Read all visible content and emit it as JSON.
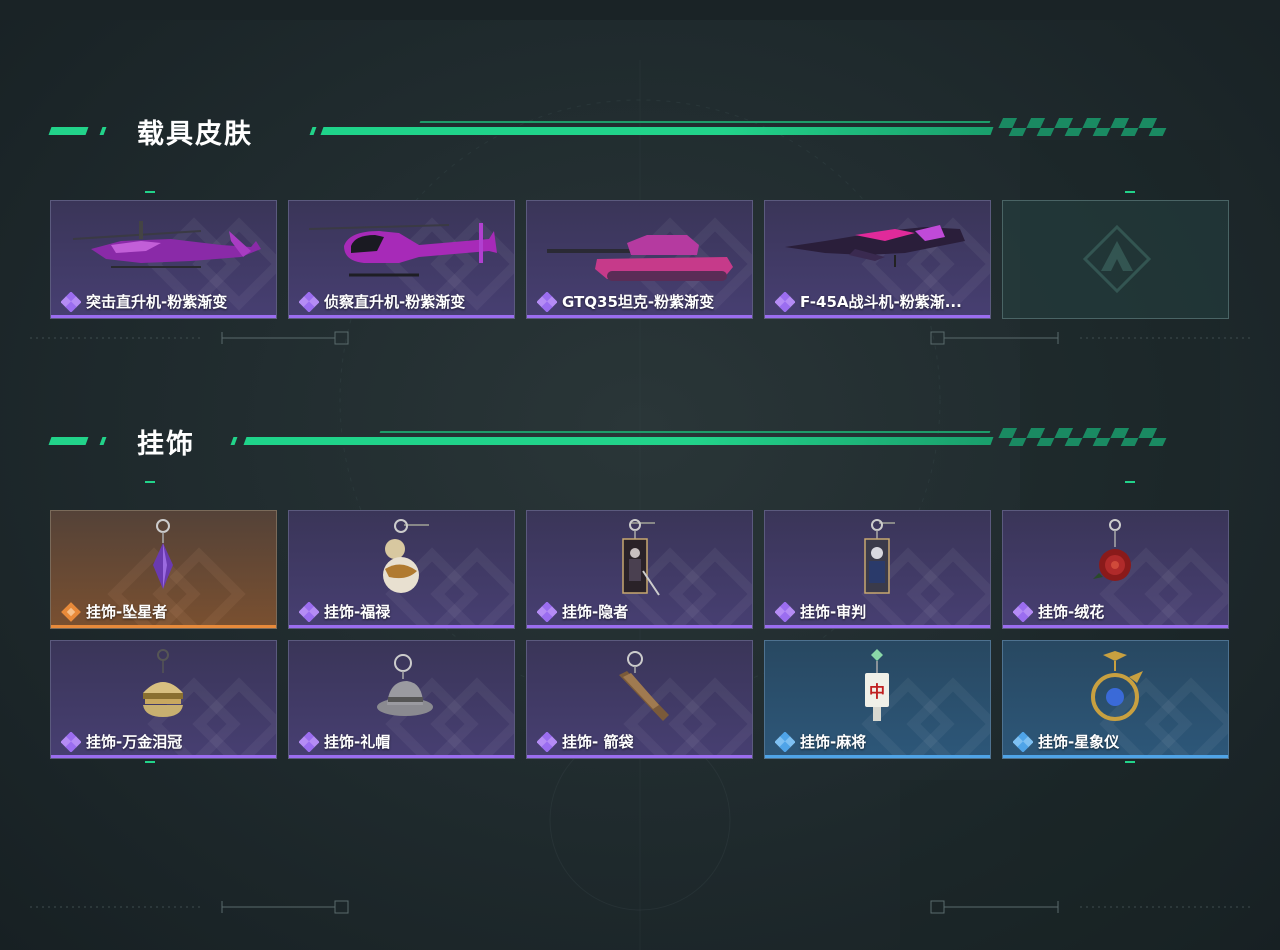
{
  "colors": {
    "accent_green": "#22d38a",
    "rare_purple": "#9b6df0",
    "legend_orange": "#e88a3a",
    "epic_blue": "#4fa4e8"
  },
  "sections": {
    "vehicle_skins": {
      "title": "载具皮肤",
      "items": [
        {
          "name": "突击直升机-粉紫渐变",
          "rarity": "purple",
          "icon": "attack-helicopter-icon"
        },
        {
          "name": "侦察直升机-粉紫渐变",
          "rarity": "purple",
          "icon": "scout-helicopter-icon"
        },
        {
          "name": "GTQ35坦克-粉紫渐变",
          "rarity": "purple",
          "icon": "tank-icon"
        },
        {
          "name": "F-45A战斗机-粉紫渐...",
          "rarity": "purple",
          "icon": "fighter-jet-icon"
        },
        {
          "name": "",
          "rarity": "empty",
          "icon": "game-logo-icon"
        }
      ]
    },
    "charms": {
      "title": "挂饰",
      "items": [
        {
          "name": "挂饰-坠星者",
          "rarity": "orange",
          "icon": "crystal-charm-icon"
        },
        {
          "name": "挂饰-福禄",
          "rarity": "purple",
          "icon": "gourd-charm-icon"
        },
        {
          "name": "挂饰-隐者",
          "rarity": "purple",
          "icon": "tarot-card-charm-icon"
        },
        {
          "name": "挂饰-审判",
          "rarity": "purple",
          "icon": "tarot-card-charm-icon"
        },
        {
          "name": "挂饰-绒花",
          "rarity": "purple",
          "icon": "rose-charm-icon"
        },
        {
          "name": "挂饰-万金泪冠",
          "rarity": "purple",
          "icon": "burger-charm-icon"
        },
        {
          "name": "挂饰-礼帽",
          "rarity": "purple",
          "icon": "hat-charm-icon"
        },
        {
          "name": "挂饰- 箭袋",
          "rarity": "purple",
          "icon": "quiver-charm-icon"
        },
        {
          "name": "挂饰-麻将",
          "rarity": "blue",
          "icon": "mahjong-charm-icon"
        },
        {
          "name": "挂饰-星象仪",
          "rarity": "blue",
          "icon": "astrolabe-charm-icon"
        }
      ]
    }
  }
}
